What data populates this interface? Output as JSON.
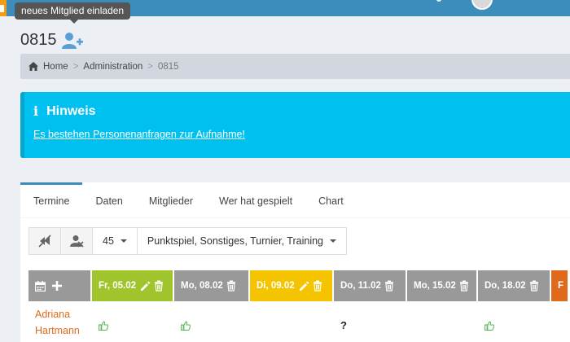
{
  "tooltip": {
    "text": "neues Mitglied einladen"
  },
  "page": {
    "title": "0815",
    "add_member_icon": "user-plus-icon"
  },
  "breadcrumb": {
    "items": [
      {
        "label": "Home",
        "icon": "home-icon"
      },
      {
        "label": "Administration"
      },
      {
        "label": "0815"
      }
    ],
    "separator": ">"
  },
  "callout": {
    "icon": "info-icon",
    "icon_glyph": "i",
    "title": "Hinweis",
    "link": "Es bestehen Personenanfragen zur Aufnahme!",
    "color": "#00c0ef"
  },
  "tabs": [
    {
      "label": "Termine",
      "active": true
    },
    {
      "label": "Daten"
    },
    {
      "label": "Mitglieder"
    },
    {
      "label": "Wer hat gespielt"
    },
    {
      "label": "Chart"
    }
  ],
  "toolbar": {
    "count_value": "45",
    "filter_value": "Punktspiel, Sonstiges, Turnier, Training"
  },
  "table": {
    "header_icons": [
      "calendar-icon",
      "plus-icon"
    ],
    "columns": [
      {
        "label": "Fr, 05.02",
        "color": "#a0c42b",
        "editable": true
      },
      {
        "label": "Mo, 08.02",
        "color": "#999999",
        "editable": false
      },
      {
        "label": "Di, 09.02",
        "color": "#f4c400",
        "editable": true
      },
      {
        "label": "Do, 11.02",
        "color": "#999999",
        "editable": false
      },
      {
        "label": "Mo, 15.02",
        "color": "#999999",
        "editable": false
      },
      {
        "label": "Do, 18.02",
        "color": "#999999",
        "editable": false
      },
      {
        "label": "F",
        "color": "#e06a1b",
        "editable": false
      }
    ],
    "rows": [
      {
        "name_first": "Adriana",
        "name_last": "Hartmann",
        "cells": [
          "thumbs-up",
          "thumbs-up",
          "",
          "?",
          "",
          "thumbs-up",
          ""
        ]
      }
    ],
    "colors": {
      "like": "#5cb85c",
      "name": "#e06a1b",
      "header_gray": "#999999"
    }
  }
}
